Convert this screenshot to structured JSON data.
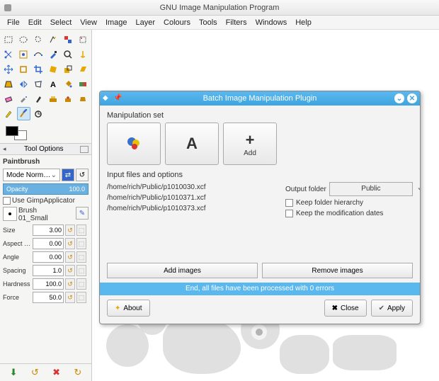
{
  "window": {
    "title": "GNU Image Manipulation Program"
  },
  "menu": [
    "File",
    "Edit",
    "Select",
    "View",
    "Image",
    "Layer",
    "Colours",
    "Tools",
    "Filters",
    "Windows",
    "Help"
  ],
  "toolopts": {
    "header": "Tool Options",
    "title": "Paintbrush",
    "mode": "Mode  Norm…",
    "opacity_label": "Opacity",
    "opacity_val": "100.0",
    "gimpapp": "Use GimpApplicator",
    "brush_label": "Brush",
    "brush_name": "01_Small",
    "spins": [
      {
        "l": "Size",
        "v": "3.00"
      },
      {
        "l": "Aspect …",
        "v": "0.00"
      },
      {
        "l": "Angle",
        "v": "0.00"
      },
      {
        "l": "Spacing",
        "v": "1.0"
      },
      {
        "l": "Hardness",
        "v": "100.0"
      },
      {
        "l": "Force",
        "v": "50.0"
      }
    ]
  },
  "dialog": {
    "title": "Batch Image Manipulation Plugin",
    "manip_label": "Manipulation set",
    "add": "Add",
    "files_label": "Input files and options",
    "files": [
      "/home/rich/Public/p1010030.xcf",
      "/home/rich/Public/p1010371.xcf",
      "/home/rich/Public/p1010373.xcf"
    ],
    "out_label": "Output folder",
    "out_folder": "Public",
    "keep_hier": "Keep folder hierarchy",
    "keep_dates": "Keep the modification dates",
    "add_images": "Add images",
    "remove_images": "Remove images",
    "status": "End, all files have been processed with 0 errors",
    "about": "About",
    "close": "Close",
    "apply": "Apply"
  }
}
